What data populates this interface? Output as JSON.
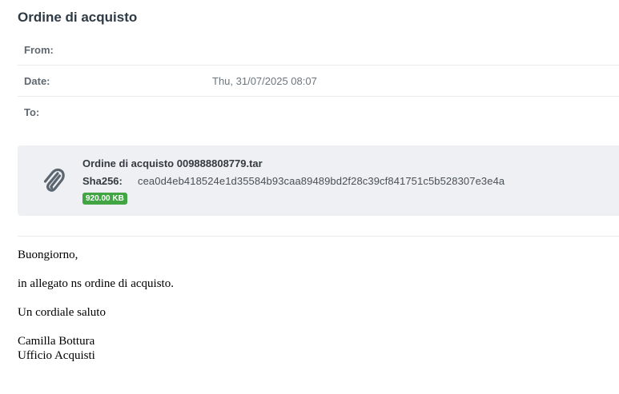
{
  "email": {
    "subject": "Ordine di acquisto",
    "headers": {
      "from_label": "From:",
      "from_value": "",
      "date_label": "Date:",
      "date_value": "Thu, 31/07/2025 08:07",
      "to_label": "To:",
      "to_value": ""
    },
    "attachment": {
      "icon": "paperclip-icon",
      "filename": "Ordine di acquisto 009888808779.tar",
      "hash_label": "Sha256:",
      "hash_value": "cea0d4eb418524e1d35584b93caa89489bd2f28c39cf841751c5b528307e3e4a",
      "size": "920.00 KB",
      "size_badge_color": "#41a544"
    },
    "body": {
      "greeting": "Buongiorno,",
      "line1": "in allegato ns ordine di acquisto.",
      "closing": "Un cordiale saluto",
      "signature_name": "Camilla Bottura",
      "signature_dept": "Ufficio Acquisti"
    }
  }
}
